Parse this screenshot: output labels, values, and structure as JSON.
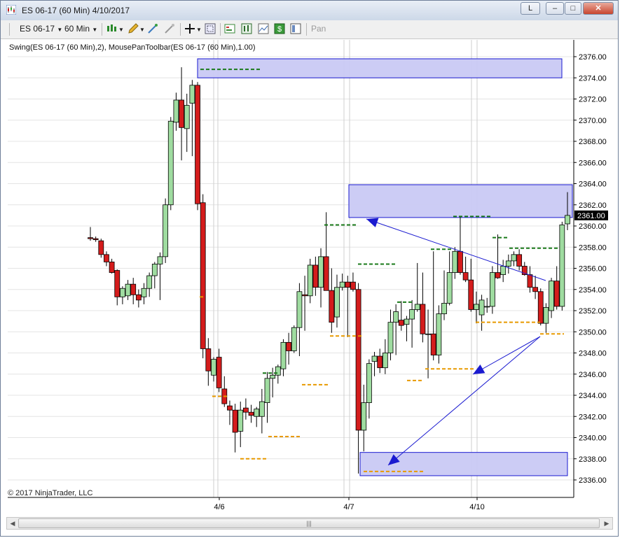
{
  "window": {
    "title": "ES 06-17 (60 Min)  4/10/2017",
    "btn_l": "L",
    "btn_min": "–",
    "btn_max": "□",
    "btn_close": "✕"
  },
  "toolbar": {
    "instrument": "ES 06-17",
    "interval": "60 Min",
    "pan": "Pan",
    "icons": [
      "bars-type-icon",
      "drawing-pencil-icon",
      "indicator-icon",
      "strategy-icon",
      "crosshair-icon",
      "zoom-icon",
      "properties-icon",
      "chart-style-icon",
      "line-icon",
      "dollar-icon",
      "data-box-icon"
    ]
  },
  "chart": {
    "indicator_label": "Swing(ES 06-17 (60 Min),2), MousePanToolbar(ES 06-17 (60 Min),1.00)",
    "copyright": "© 2017 NinjaTrader, LLC",
    "price_ticks": [
      "2376.00",
      "2374.00",
      "2372.00",
      "2370.00",
      "2368.00",
      "2366.00",
      "2364.00",
      "2362.00",
      "2360.00",
      "2358.00",
      "2356.00",
      "2354.00",
      "2352.00",
      "2350.00",
      "2348.00",
      "2346.00",
      "2344.00",
      "2342.00",
      "2340.00",
      "2338.00",
      "2336.00"
    ],
    "current_price": "2361.00",
    "time_labels": [
      "4/6",
      "4/7",
      "4/10"
    ]
  },
  "chart_data": {
    "type": "candlestick",
    "ylim": [
      2335.0,
      2377.0
    ],
    "price_ticks": [
      2376,
      2374,
      2372,
      2370,
      2368,
      2366,
      2364,
      2362,
      2360,
      2358,
      2356,
      2354,
      2352,
      2350,
      2348,
      2346,
      2344,
      2342,
      2340,
      2338,
      2336
    ],
    "last_price": 2361.0,
    "time_labels": [
      "4/6",
      "4/7",
      "4/10"
    ],
    "candles": [
      {
        "o": 2358.9,
        "h": 2359.9,
        "l": 2358.6,
        "c": 2358.8
      },
      {
        "o": 2358.8,
        "h": 2359.0,
        "l": 2358.5,
        "c": 2358.7
      },
      {
        "o": 2358.6,
        "h": 2358.8,
        "l": 2357.0,
        "c": 2357.3
      },
      {
        "o": 2357.3,
        "h": 2357.6,
        "l": 2356.2,
        "c": 2356.6
      },
      {
        "o": 2356.6,
        "h": 2356.9,
        "l": 2355.5,
        "c": 2355.6
      },
      {
        "o": 2355.8,
        "h": 2355.9,
        "l": 2352.5,
        "c": 2353.3
      },
      {
        "o": 2353.3,
        "h": 2354.3,
        "l": 2352.6,
        "c": 2354.1
      },
      {
        "o": 2353.4,
        "h": 2354.9,
        "l": 2353.0,
        "c": 2354.5
      },
      {
        "o": 2354.5,
        "h": 2355.1,
        "l": 2352.6,
        "c": 2353.5
      },
      {
        "o": 2353.5,
        "h": 2354.0,
        "l": 2352.3,
        "c": 2353.0
      },
      {
        "o": 2353.3,
        "h": 2354.6,
        "l": 2352.6,
        "c": 2354.1
      },
      {
        "o": 2354.1,
        "h": 2355.6,
        "l": 2353.3,
        "c": 2355.3
      },
      {
        "o": 2355.3,
        "h": 2356.6,
        "l": 2354.1,
        "c": 2356.4
      },
      {
        "o": 2356.4,
        "h": 2357.5,
        "l": 2353.0,
        "c": 2357.1
      },
      {
        "o": 2357.1,
        "h": 2362.6,
        "l": 2356.5,
        "c": 2362.0
      },
      {
        "o": 2362.0,
        "h": 2370.3,
        "l": 2361.5,
        "c": 2369.9
      },
      {
        "o": 2369.8,
        "h": 2372.6,
        "l": 2369.0,
        "c": 2371.9
      },
      {
        "o": 2371.9,
        "h": 2375.0,
        "l": 2366.2,
        "c": 2369.3
      },
      {
        "o": 2369.2,
        "h": 2372.5,
        "l": 2367.0,
        "c": 2371.4
      },
      {
        "o": 2371.6,
        "h": 2373.8,
        "l": 2366.6,
        "c": 2373.3
      },
      {
        "o": 2373.3,
        "h": 2373.6,
        "l": 2361.5,
        "c": 2362.1
      },
      {
        "o": 2362.2,
        "h": 2363.0,
        "l": 2347.5,
        "c": 2348.4
      },
      {
        "o": 2348.4,
        "h": 2349.4,
        "l": 2344.9,
        "c": 2346.3
      },
      {
        "o": 2345.9,
        "h": 2347.6,
        "l": 2345.3,
        "c": 2347.4
      },
      {
        "o": 2347.6,
        "h": 2348.4,
        "l": 2344.3,
        "c": 2344.7
      },
      {
        "o": 2344.6,
        "h": 2345.8,
        "l": 2342.9,
        "c": 2343.2
      },
      {
        "o": 2343.0,
        "h": 2343.5,
        "l": 2341.2,
        "c": 2342.6
      },
      {
        "o": 2342.6,
        "h": 2343.2,
        "l": 2338.6,
        "c": 2340.5
      },
      {
        "o": 2340.6,
        "h": 2343.4,
        "l": 2339.1,
        "c": 2342.6
      },
      {
        "o": 2342.8,
        "h": 2343.7,
        "l": 2341.7,
        "c": 2342.4
      },
      {
        "o": 2342.4,
        "h": 2343.1,
        "l": 2341.4,
        "c": 2342.1
      },
      {
        "o": 2342.0,
        "h": 2342.9,
        "l": 2341.0,
        "c": 2342.7
      },
      {
        "o": 2342.0,
        "h": 2344.6,
        "l": 2340.4,
        "c": 2343.4
      },
      {
        "o": 2343.3,
        "h": 2346.2,
        "l": 2341.4,
        "c": 2345.6
      },
      {
        "o": 2345.6,
        "h": 2346.6,
        "l": 2343.8,
        "c": 2345.9
      },
      {
        "o": 2345.9,
        "h": 2346.9,
        "l": 2345.1,
        "c": 2346.7
      },
      {
        "o": 2346.5,
        "h": 2349.3,
        "l": 2345.8,
        "c": 2349.0
      },
      {
        "o": 2349.0,
        "h": 2349.9,
        "l": 2346.9,
        "c": 2348.2
      },
      {
        "o": 2348.2,
        "h": 2350.6,
        "l": 2348.0,
        "c": 2350.4
      },
      {
        "o": 2350.4,
        "h": 2354.6,
        "l": 2347.7,
        "c": 2353.8
      },
      {
        "o": 2353.5,
        "h": 2355.3,
        "l": 2350.1,
        "c": 2353.4
      },
      {
        "o": 2353.4,
        "h": 2356.9,
        "l": 2352.7,
        "c": 2356.3
      },
      {
        "o": 2356.3,
        "h": 2357.1,
        "l": 2353.4,
        "c": 2354.2
      },
      {
        "o": 2354.2,
        "h": 2357.9,
        "l": 2352.3,
        "c": 2357.1
      },
      {
        "o": 2357.1,
        "h": 2361.3,
        "l": 2355.9,
        "c": 2353.9
      },
      {
        "o": 2353.9,
        "h": 2356.0,
        "l": 2349.9,
        "c": 2350.9
      },
      {
        "o": 2351.4,
        "h": 2355.4,
        "l": 2350.4,
        "c": 2354.2
      },
      {
        "o": 2354.2,
        "h": 2355.5,
        "l": 2353.9,
        "c": 2354.7
      },
      {
        "o": 2354.7,
        "h": 2355.3,
        "l": 2349.5,
        "c": 2354.2
      },
      {
        "o": 2354.7,
        "h": 2355.6,
        "l": 2353.8,
        "c": 2354.0
      },
      {
        "o": 2354.0,
        "h": 2354.6,
        "l": 2336.6,
        "c": 2340.7
      },
      {
        "o": 2340.7,
        "h": 2345.0,
        "l": 2338.7,
        "c": 2343.3
      },
      {
        "o": 2343.3,
        "h": 2347.4,
        "l": 2341.8,
        "c": 2347.0
      },
      {
        "o": 2347.2,
        "h": 2348.1,
        "l": 2345.8,
        "c": 2347.7
      },
      {
        "o": 2347.7,
        "h": 2348.4,
        "l": 2346.1,
        "c": 2346.6
      },
      {
        "o": 2346.6,
        "h": 2349.3,
        "l": 2346.0,
        "c": 2348.0
      },
      {
        "o": 2348.0,
        "h": 2352.1,
        "l": 2347.3,
        "c": 2350.9
      },
      {
        "o": 2350.9,
        "h": 2352.6,
        "l": 2347.8,
        "c": 2351.9
      },
      {
        "o": 2351.1,
        "h": 2352.9,
        "l": 2350.1,
        "c": 2350.6
      },
      {
        "o": 2350.7,
        "h": 2351.5,
        "l": 2349.1,
        "c": 2351.2
      },
      {
        "o": 2351.2,
        "h": 2353.0,
        "l": 2348.5,
        "c": 2352.1
      },
      {
        "o": 2352.1,
        "h": 2356.5,
        "l": 2351.9,
        "c": 2352.6
      },
      {
        "o": 2352.6,
        "h": 2355.6,
        "l": 2349.0,
        "c": 2349.8
      },
      {
        "o": 2349.8,
        "h": 2352.1,
        "l": 2345.6,
        "c": 2349.8
      },
      {
        "o": 2349.8,
        "h": 2357.6,
        "l": 2347.3,
        "c": 2347.8
      },
      {
        "o": 2347.8,
        "h": 2352.5,
        "l": 2347.0,
        "c": 2351.7
      },
      {
        "o": 2351.7,
        "h": 2355.8,
        "l": 2351.1,
        "c": 2352.7
      },
      {
        "o": 2352.7,
        "h": 2357.6,
        "l": 2352.5,
        "c": 2355.6
      },
      {
        "o": 2355.6,
        "h": 2358.0,
        "l": 2355.0,
        "c": 2357.6
      },
      {
        "o": 2357.6,
        "h": 2360.9,
        "l": 2355.4,
        "c": 2355.6
      },
      {
        "o": 2355.6,
        "h": 2357.1,
        "l": 2354.7,
        "c": 2354.9
      },
      {
        "o": 2354.9,
        "h": 2356.9,
        "l": 2351.9,
        "c": 2352.1
      },
      {
        "o": 2352.1,
        "h": 2353.8,
        "l": 2350.8,
        "c": 2352.6
      },
      {
        "o": 2351.6,
        "h": 2353.5,
        "l": 2350.1,
        "c": 2353.0
      },
      {
        "o": 2352.4,
        "h": 2353.2,
        "l": 2351.8,
        "c": 2352.4
      },
      {
        "o": 2352.4,
        "h": 2356.2,
        "l": 2351.7,
        "c": 2355.6
      },
      {
        "o": 2355.6,
        "h": 2359.2,
        "l": 2355.0,
        "c": 2355.1
      },
      {
        "o": 2355.4,
        "h": 2356.8,
        "l": 2354.7,
        "c": 2356.2
      },
      {
        "o": 2356.2,
        "h": 2357.3,
        "l": 2355.5,
        "c": 2356.7
      },
      {
        "o": 2356.7,
        "h": 2357.6,
        "l": 2356.2,
        "c": 2357.3
      },
      {
        "o": 2357.3,
        "h": 2357.8,
        "l": 2355.8,
        "c": 2356.2
      },
      {
        "o": 2356.2,
        "h": 2356.6,
        "l": 2355.3,
        "c": 2355.4
      },
      {
        "o": 2355.4,
        "h": 2356.2,
        "l": 2353.7,
        "c": 2354.2
      },
      {
        "o": 2354.2,
        "h": 2355.3,
        "l": 2353.1,
        "c": 2353.8
      },
      {
        "o": 2353.8,
        "h": 2354.1,
        "l": 2350.6,
        "c": 2350.8
      },
      {
        "o": 2350.8,
        "h": 2352.7,
        "l": 2349.9,
        "c": 2352.3
      },
      {
        "o": 2352.0,
        "h": 2355.1,
        "l": 2351.3,
        "c": 2354.8
      },
      {
        "o": 2354.8,
        "h": 2356.2,
        "l": 2352.1,
        "c": 2352.4
      },
      {
        "o": 2352.4,
        "h": 2360.4,
        "l": 2352.0,
        "c": 2360.1
      },
      {
        "o": 2360.2,
        "h": 2363.2,
        "l": 2359.6,
        "c": 2361.0
      }
    ],
    "zones": [
      {
        "x0": 0.36,
        "x1": 1.0,
        "y0": 2374.0,
        "y1": 2375.8
      },
      {
        "x0": 0.61,
        "x1": 1.0,
        "y0": 2360.8,
        "y1": 2363.9
      },
      {
        "x0": 0.63,
        "x1": 1.0,
        "y0": 2336.4,
        "y1": 2338.6
      }
    ],
    "swing_highs": [
      2374.8,
      2360.1,
      2356.4,
      2352.8,
      2357.8,
      2360.9,
      2358.9,
      2357.9,
      2346.1
    ],
    "swing_lows": [
      2343.9,
      2338.0,
      2340.1,
      2345.0,
      2349.6,
      2346.5,
      2345.4,
      2350.9,
      2349.8,
      2336.8,
      2353.3
    ]
  }
}
